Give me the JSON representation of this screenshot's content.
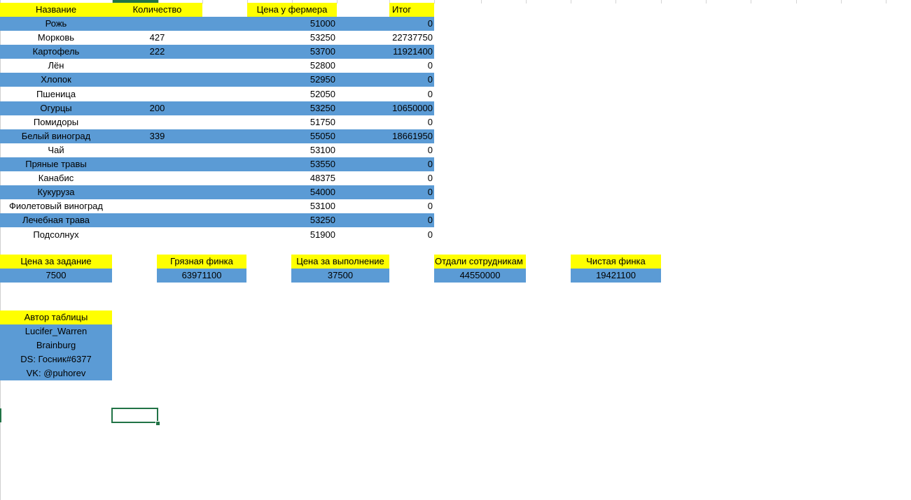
{
  "headers": {
    "name": "Название",
    "quantity": "Количество",
    "price": "Цена у фермера",
    "total": "Итог"
  },
  "rows": [
    {
      "name": "Рожь",
      "quantity": "",
      "price": "51000",
      "total": "0"
    },
    {
      "name": "Морковь",
      "quantity": "427",
      "price": "53250",
      "total": "22737750"
    },
    {
      "name": "Картофель",
      "quantity": "222",
      "price": "53700",
      "total": "11921400"
    },
    {
      "name": "Лён",
      "quantity": "",
      "price": "52800",
      "total": "0"
    },
    {
      "name": "Хлопок",
      "quantity": "",
      "price": "52950",
      "total": "0"
    },
    {
      "name": "Пшеница",
      "quantity": "",
      "price": "52050",
      "total": "0"
    },
    {
      "name": "Огурцы",
      "quantity": "200",
      "price": "53250",
      "total": "10650000"
    },
    {
      "name": "Помидоры",
      "quantity": "",
      "price": "51750",
      "total": "0"
    },
    {
      "name": "Белый виноград",
      "quantity": "339",
      "price": "55050",
      "total": "18661950"
    },
    {
      "name": "Чай",
      "quantity": "",
      "price": "53100",
      "total": "0"
    },
    {
      "name": "Пряные травы",
      "quantity": "",
      "price": "53550",
      "total": "0"
    },
    {
      "name": "Канабис",
      "quantity": "",
      "price": "48375",
      "total": "0"
    },
    {
      "name": "Кукуруза",
      "quantity": "",
      "price": "54000",
      "total": "0"
    },
    {
      "name": "Фиолетовый виноград",
      "quantity": "",
      "price": "53100",
      "total": "0"
    },
    {
      "name": "Лечебная трава",
      "quantity": "",
      "price": "53250",
      "total": "0"
    },
    {
      "name": "Подсолнух",
      "quantity": "",
      "price": "51900",
      "total": "0"
    }
  ],
  "summary": {
    "task_price_label": "Цена за задание",
    "task_price_value": "7500",
    "gross_label": "Грязная финка",
    "gross_value": "63971100",
    "exec_price_label": "Цена за выполнение",
    "exec_price_value": "37500",
    "paid_staff_label": "Отдали сотрудникам",
    "paid_staff_value": "44550000",
    "net_label": "Чистая финка",
    "net_value": "19421100"
  },
  "author": {
    "label": "Автор таблицы",
    "lines": [
      "Lucifer_Warren",
      "Brainburg",
      "DS: Госник#6377",
      "VK: @puhorev"
    ]
  },
  "colors": {
    "header_yellow": "#ffff00",
    "band_blue": "#5b9bd5",
    "selection_green": "#217346"
  }
}
